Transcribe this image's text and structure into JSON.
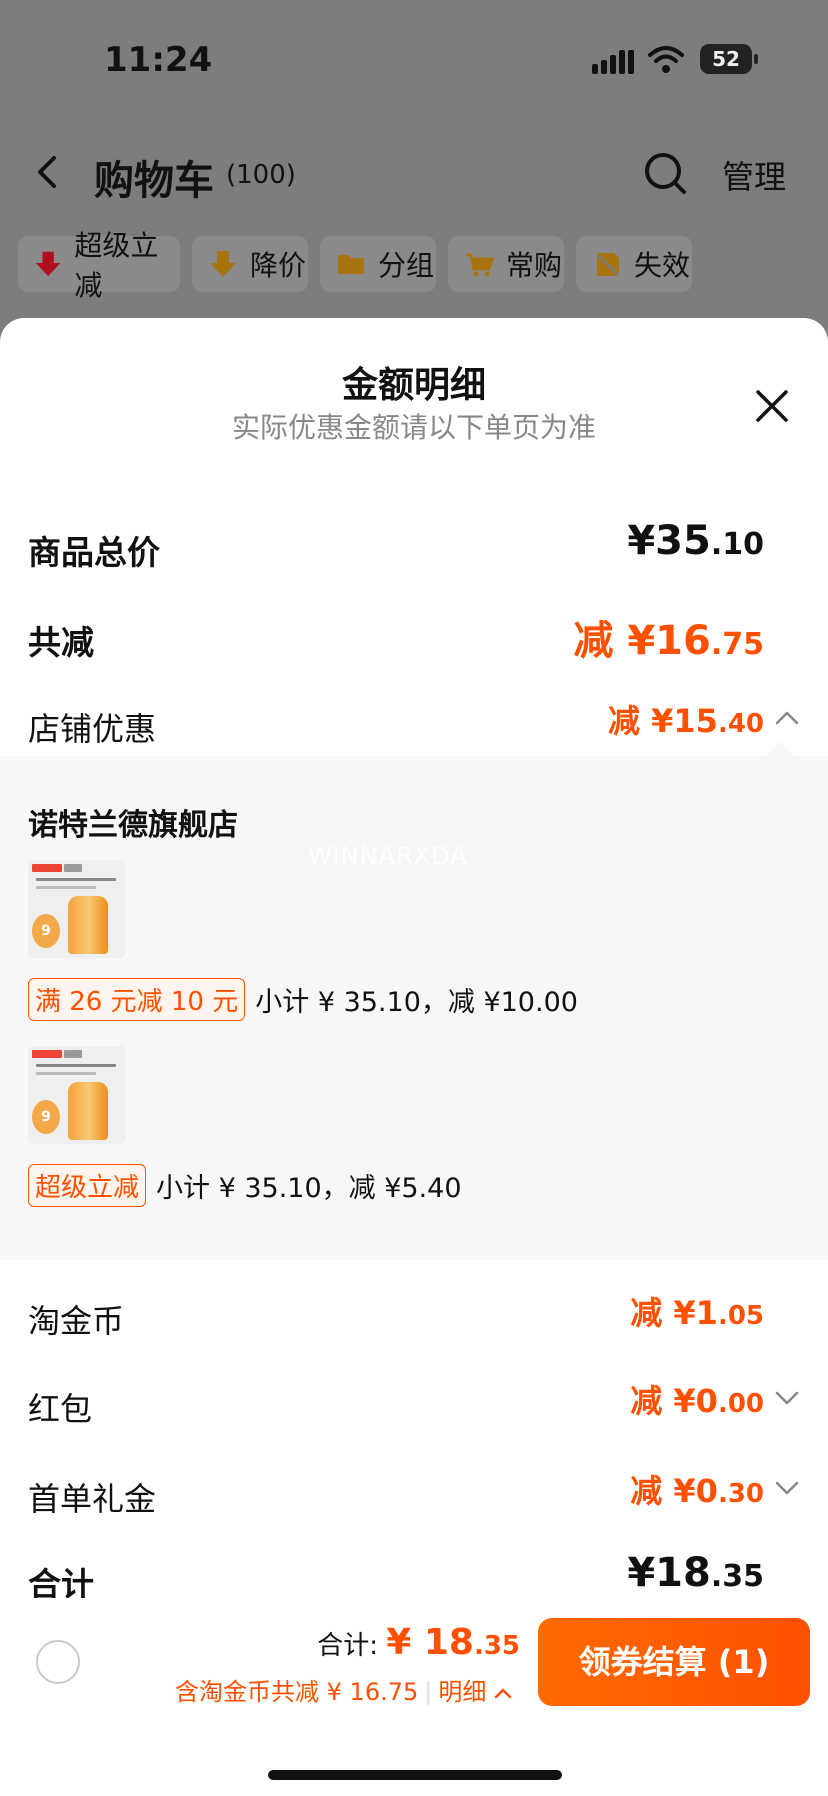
{
  "status_bar": {
    "time": "11:24",
    "battery": "52"
  },
  "header": {
    "back_icon": "chevron-left-icon",
    "title": "购物车",
    "count": "(100)",
    "search_icon": "search-icon",
    "manage": "管理"
  },
  "filter_chips": [
    {
      "label": "超级立减",
      "icon": "arrow-down-red-icon",
      "color": "#e2132a"
    },
    {
      "label": "降价",
      "icon": "arrow-down-yellow-icon",
      "color": "#e8a21a"
    },
    {
      "label": "分组",
      "icon": "folder-icon",
      "color": "#e8a21a"
    },
    {
      "label": "常购",
      "icon": "cart-icon",
      "color": "#e8a21a"
    },
    {
      "label": "失效",
      "icon": "invalid-icon",
      "color": "#e8a21a"
    }
  ],
  "sheet": {
    "title": "金额明细",
    "subtitle": "实际优惠金额请以下单页为准",
    "close_icon": "close-icon",
    "goods_total": {
      "label": "商品总价",
      "yen": "¥",
      "int": "35",
      "dec": ".10"
    },
    "total_discount": {
      "label": "共减",
      "prefix": "减 ",
      "yen": "¥",
      "int": "16",
      "dec": ".75"
    },
    "shop_discount": {
      "label": "店铺优惠",
      "prefix": "减 ",
      "yen": "¥",
      "int": "15",
      "dec": ".40",
      "chevron": "chevron-up-icon"
    },
    "shop": {
      "name": "诺特兰德旗舰店",
      "watermark": "WINNARXDA",
      "items": [
        {
          "thumb_badge": "9",
          "tag": "满 26 元减 10 元",
          "detail": "小计 ¥ 35.10，减 ¥10.00"
        },
        {
          "thumb_badge": "9",
          "tag": "超级立减",
          "detail": "小计 ¥ 35.10，减 ¥5.40"
        }
      ]
    },
    "taojinbi": {
      "label": "淘金币",
      "prefix": "减 ",
      "yen": "¥",
      "int": "1",
      "dec": ".05"
    },
    "hongbao": {
      "label": "红包",
      "prefix": "减 ",
      "yen": "¥",
      "int": "0",
      "dec": ".00",
      "chevron": "chevron-down-icon"
    },
    "first_gift": {
      "label": "首单礼金",
      "prefix": "减 ",
      "yen": "¥",
      "int": "0",
      "dec": ".30",
      "chevron": "chevron-down-icon"
    },
    "sum": {
      "label": "合计",
      "yen": "¥",
      "int": "18",
      "dec": ".35"
    }
  },
  "footer": {
    "total_label": "合计: ",
    "total_yen": "¥ ",
    "total_int": "18",
    "total_dec": ".35",
    "saved_text": "含淘金币共减 ¥ 16.75",
    "detail_link": "明细",
    "detail_icon": "chevron-up-icon",
    "checkout": "领券结算 (1)"
  }
}
